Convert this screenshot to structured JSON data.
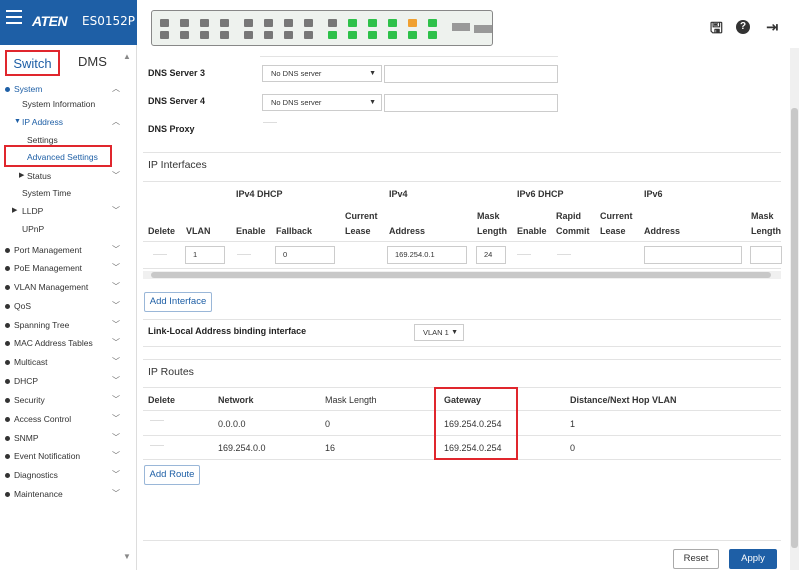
{
  "brand": {
    "logo": "ATEN",
    "model": "ES0152P"
  },
  "tabs": {
    "switch": "Switch",
    "dms": "DMS"
  },
  "nav": {
    "system": "System",
    "system_information": "System Information",
    "ip_address": "IP Address",
    "settings": "Settings",
    "advanced_settings": "Advanced Settings",
    "status": "Status",
    "system_time": "System Time",
    "lldp": "LLDP",
    "upnp": "UPnP",
    "port_management": "Port Management",
    "poe_management": "PoE Management",
    "vlan_management": "VLAN Management",
    "qos": "QoS",
    "spanning_tree": "Spanning Tree",
    "mac_address_tables": "MAC Address Tables",
    "multicast": "Multicast",
    "dhcp": "DHCP",
    "security": "Security",
    "access_control": "Access Control",
    "snmp": "SNMP",
    "event_notification": "Event Notification",
    "diagnostics": "Diagnostics",
    "maintenance": "Maintenance"
  },
  "dns": {
    "server3_label": "DNS Server 3",
    "server3_value": "No DNS server",
    "server4_label": "DNS Server 4",
    "server4_value": "No DNS server",
    "proxy_label": "DNS Proxy"
  },
  "ip_interfaces": {
    "title": "IP Interfaces",
    "group_ipv4dhcp": "IPv4 DHCP",
    "group_ipv4": "IPv4",
    "group_ipv6dhcp": "IPv6 DHCP",
    "group_ipv6": "IPv6",
    "col_delete": "Delete",
    "col_vlan": "VLAN",
    "col_enable": "Enable",
    "col_fallback": "Fallback",
    "col_current_lease_1": "Current",
    "col_current_lease_2": "Lease",
    "col_address": "Address",
    "col_mask_1": "Mask",
    "col_mask_2": "Length",
    "col_enable6": "Enable",
    "col_rapid_1": "Rapid",
    "col_rapid_2": "Commit",
    "col_current6_1": "Current",
    "col_current6_2": "Lease",
    "col_address6": "Address",
    "col_mask6_1": "Mask",
    "col_mask6_2": "Length",
    "row": {
      "vlan": "1",
      "fallback": "0",
      "address": "169.254.0.1",
      "mask": "24"
    },
    "add_button": "Add Interface"
  },
  "link_local": {
    "label": "Link-Local Address binding interface",
    "value": "VLAN 1"
  },
  "ip_routes": {
    "title": "IP Routes",
    "col_delete": "Delete",
    "col_network": "Network",
    "col_mask": "Mask Length",
    "col_gateway": "Gateway",
    "col_distance": "Distance/Next Hop VLAN",
    "rows": [
      {
        "network": "0.0.0.0",
        "mask": "0",
        "gateway": "169.254.0.254",
        "distance": "1"
      },
      {
        "network": "169.254.0.0",
        "mask": "16",
        "gateway": "169.254.0.254",
        "distance": "0"
      }
    ],
    "add_button": "Add Route"
  },
  "actions": {
    "reset": "Reset",
    "apply": "Apply"
  },
  "colors": {
    "brand_blue": "#1e5fa6",
    "highlight_red": "#e0262d",
    "port_green": "#2ec14a",
    "port_orange": "#f0a030"
  }
}
